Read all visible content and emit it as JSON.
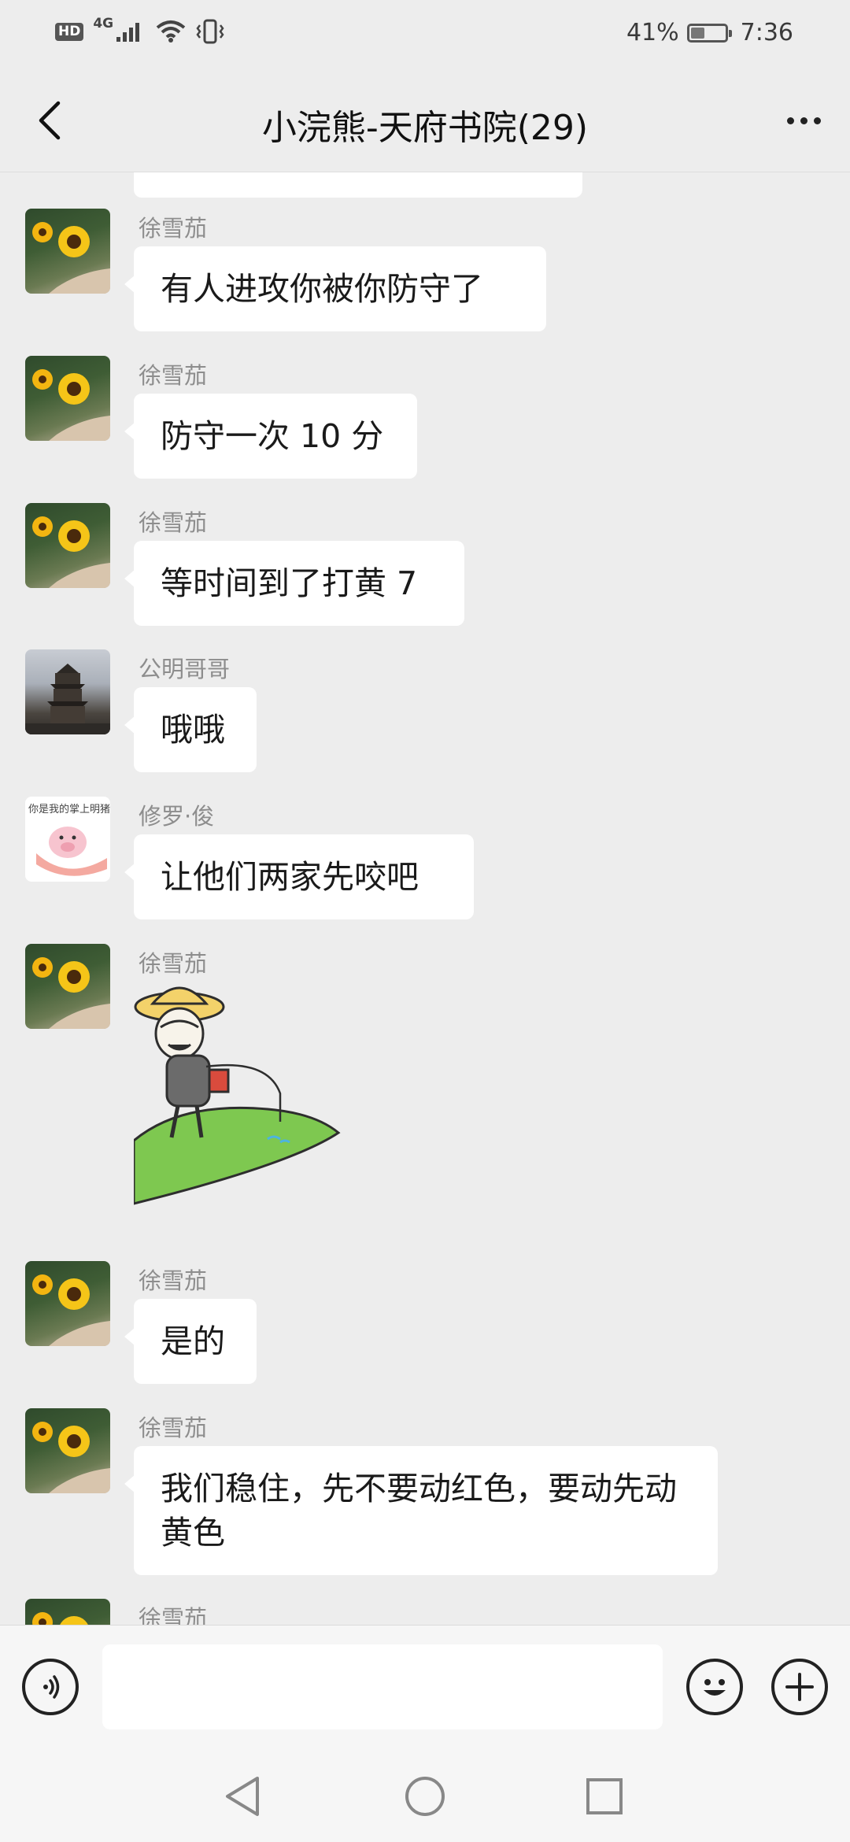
{
  "status_bar": {
    "hd": "HD",
    "network": "4G",
    "battery_percent": "41%",
    "battery_level": 0.41,
    "time": "7:36"
  },
  "header": {
    "title": "小浣熊-天府书院(29)",
    "back_icon": "chevron-left-icon",
    "more_icon": "more-dots-icon"
  },
  "messages": [
    {
      "sender": "徐雪茄",
      "avatar": "sunflower",
      "text": "有人进攻你被你防守了"
    },
    {
      "sender": "徐雪茄",
      "avatar": "sunflower",
      "text": "防守一次 10 分"
    },
    {
      "sender": "徐雪茄",
      "avatar": "sunflower",
      "text": "等时间到了打黄 7"
    },
    {
      "sender": "公明哥哥",
      "avatar": "tower",
      "text": "哦哦"
    },
    {
      "sender": "修罗·俊",
      "avatar": "pig",
      "text": "让他们两家先咬吧"
    },
    {
      "sender": "徐雪茄",
      "avatar": "sunflower",
      "sticker": "fishing-meme-sticker"
    },
    {
      "sender": "徐雪茄",
      "avatar": "sunflower",
      "text": "是的"
    },
    {
      "sender": "徐雪茄",
      "avatar": "sunflower",
      "text": "我们稳住，先不要动红色，要动先动黄色"
    },
    {
      "sender": "徐雪茄",
      "avatar": "sunflower"
    }
  ],
  "pig_avatar_text": "你是我的掌上明猪",
  "input_bar": {
    "value": "",
    "voice_icon": "voice-icon",
    "emoji_icon": "emoji-icon",
    "plus_icon": "plus-icon"
  },
  "nav": {
    "back": "nav-back-icon",
    "home": "nav-home-icon",
    "recents": "nav-recents-icon"
  },
  "colors": {
    "background": "#ededed",
    "bubble": "#ffffff",
    "sender": "#8d8d8d"
  }
}
